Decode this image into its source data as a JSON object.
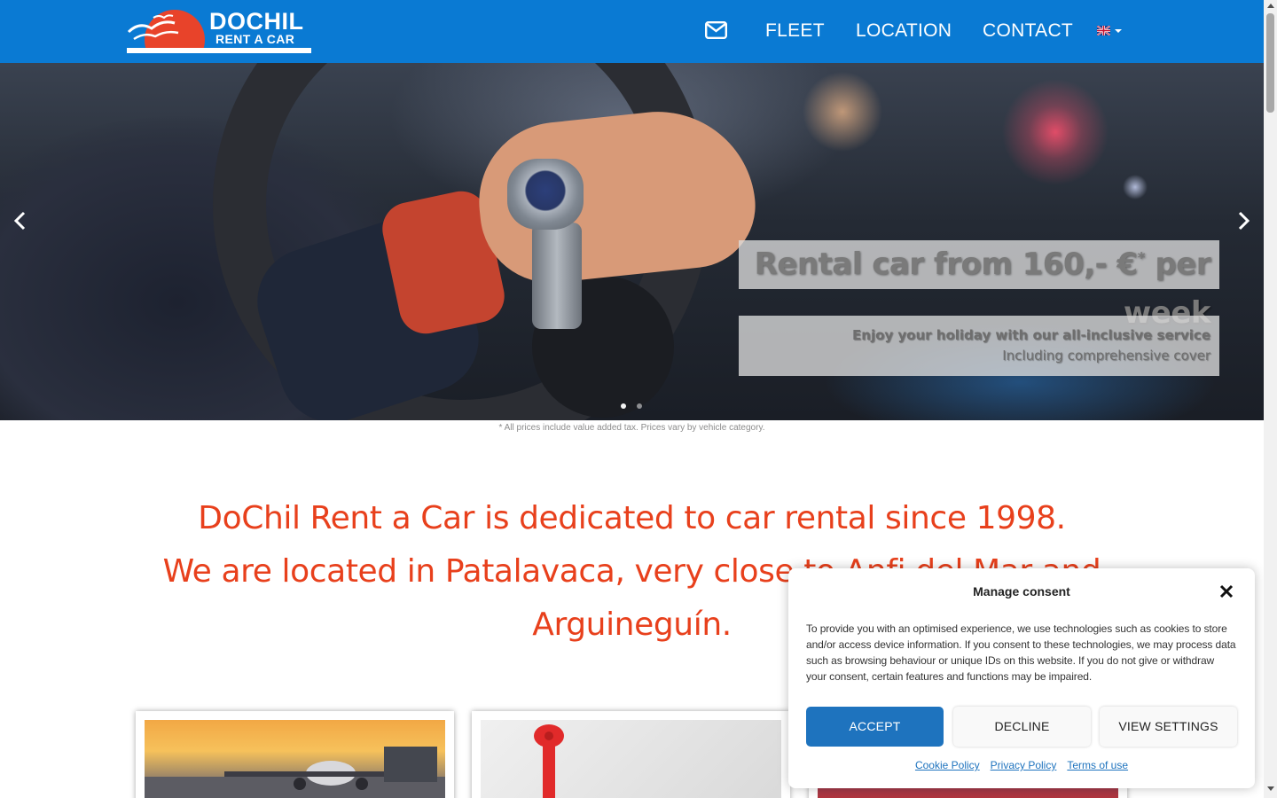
{
  "header": {
    "logo": {
      "name": "DOCHIL",
      "subtitle": "RENT A CAR"
    },
    "nav": {
      "mail_icon": "envelope-icon",
      "items": [
        {
          "label": "FLEET"
        },
        {
          "label": "LOCATION"
        },
        {
          "label": "CONTACT"
        }
      ],
      "language_icon": "uk-flag-icon"
    }
  },
  "hero": {
    "title": "Rental car from 160,- €",
    "title_sup": "*",
    "title_suffix": " per week",
    "line1": "Enjoy your holiday with our all-inclusive service",
    "line2": "Including comprehensive cover",
    "prev_icon": "chevron-left-icon",
    "next_icon": "chevron-right-icon",
    "slides": 2,
    "active_slide": 1
  },
  "price_note": "* All prices include value added tax. Prices vary by vehicle category.",
  "intro": {
    "line1": "DoChil Rent a Car is dedicated to car rental since 1998.",
    "line2": "We are located in Patalavaca, very close to Anfi del Mar and",
    "line3": "Arguineguín."
  },
  "cards": [
    {
      "image": "airport-plane-image"
    },
    {
      "image": "red-telephone-image"
    },
    {
      "image": "card-image"
    }
  ],
  "consent": {
    "title": "Manage consent",
    "close_icon": "close-icon",
    "text": "To provide you with an optimised experience, we use technologies such as cookies to store and/or access device information. If you consent to these technologies, we may process data such as browsing behaviour or unique IDs on this website. If you do not give or withdraw your consent, certain features and functions may be impaired.",
    "accept_label": "ACCEPT",
    "decline_label": "DECLINE",
    "settings_label": "VIEW SETTINGS",
    "links": [
      {
        "label": "Cookie Policy"
      },
      {
        "label": "Privacy Policy"
      },
      {
        "label": "Terms of use"
      }
    ]
  },
  "colors": {
    "navbar": "#0a7ad3",
    "brand_orange": "#e8401c",
    "accept_button": "#1e73be"
  }
}
